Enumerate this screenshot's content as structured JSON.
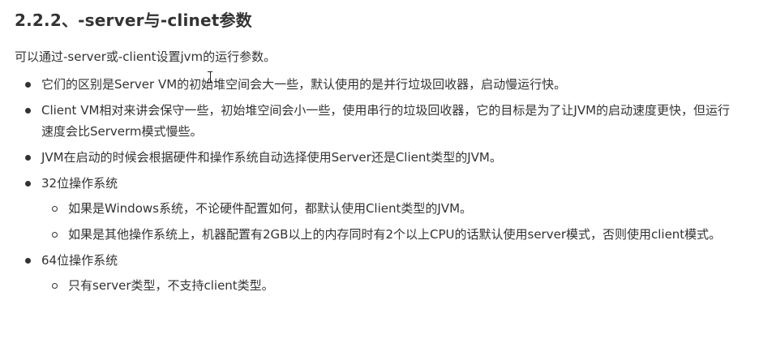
{
  "heading": "2.2.2、-server与-clinet参数",
  "intro": "可以通过-server或-client设置jvm的运行参数。",
  "items": [
    {
      "text": "它们的区别是Server VM的初始堆空间会大一些，默认使用的是并行垃圾回收器，启动慢运行快。"
    },
    {
      "text": "Client VM相对来讲会保守一些，初始堆空间会小一些，使用串行的垃圾回收器，它的目标是为了让JVM的启动速度更快，但运行速度会比Serverm模式慢些。"
    },
    {
      "text": "JVM在启动的时候会根据硬件和操作系统自动选择使用Server还是Client类型的JVM。"
    },
    {
      "text": "32位操作系统",
      "sub": [
        "如果是Windows系统，不论硬件配置如何，都默认使用Client类型的JVM。",
        "如果是其他操作系统上，机器配置有2GB以上的内存同时有2个以上CPU的话默认使用server模式，否则使用client模式。"
      ]
    },
    {
      "text": "64位操作系统",
      "sub": [
        "只有server类型，不支持client类型。"
      ]
    }
  ]
}
